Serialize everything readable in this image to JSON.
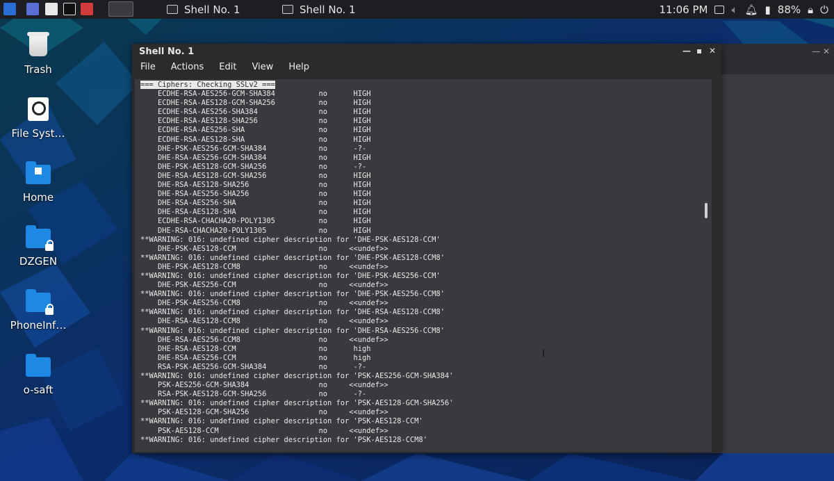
{
  "taskbar": {
    "tasks": [
      {
        "label": "Shell No. 1"
      },
      {
        "label": "Shell No. 1"
      }
    ],
    "clock": "11:06 PM",
    "battery": "88%"
  },
  "desktop": {
    "icons": [
      {
        "label": "Trash"
      },
      {
        "label": "File Syst…"
      },
      {
        "label": "Home"
      },
      {
        "label": "DZGEN"
      },
      {
        "label": "PhoneInf…"
      },
      {
        "label": "o-saft"
      }
    ]
  },
  "window": {
    "title": "Shell No. 1",
    "menu": [
      "File",
      "Actions",
      "Edit",
      "View",
      "Help"
    ],
    "header_line": "=== Ciphers: Checking SSLv2 ===",
    "lines": [
      "    ECDHE-RSA-AES256-GCM-SHA384          no      HIGH",
      "    ECDHE-RSA-AES128-GCM-SHA256          no      HIGH",
      "    ECDHE-RSA-AES256-SHA384              no      HIGH",
      "    ECDHE-RSA-AES128-SHA256              no      HIGH",
      "    ECDHE-RSA-AES256-SHA                 no      HIGH",
      "    ECDHE-RSA-AES128-SHA                 no      HIGH",
      "    DHE-PSK-AES256-GCM-SHA384            no      -?-",
      "    DHE-RSA-AES256-GCM-SHA384            no      HIGH",
      "    DHE-PSK-AES128-GCM-SHA256            no      -?-",
      "    DHE-RSA-AES128-GCM-SHA256            no      HIGH",
      "    DHE-RSA-AES128-SHA256                no      HIGH",
      "    DHE-RSA-AES256-SHA256                no      HIGH",
      "    DHE-RSA-AES256-SHA                   no      HIGH",
      "    DHE-RSA-AES128-SHA                   no      HIGH",
      "    ECDHE-RSA-CHACHA20-POLY1305          no      HIGH",
      "    DHE-RSA-CHACHA20-POLY1305            no      HIGH",
      "**WARNING: 016: undefined cipher description for 'DHE-PSK-AES128-CCM'",
      "    DHE-PSK-AES128-CCM                   no     <<undef>>",
      "**WARNING: 016: undefined cipher description for 'DHE-PSK-AES128-CCM8'",
      "    DHE-PSK-AES128-CCM8                  no     <<undef>>",
      "**WARNING: 016: undefined cipher description for 'DHE-PSK-AES256-CCM'",
      "    DHE-PSK-AES256-CCM                   no     <<undef>>",
      "**WARNING: 016: undefined cipher description for 'DHE-PSK-AES256-CCM8'",
      "    DHE-PSK-AES256-CCM8                  no     <<undef>>",
      "**WARNING: 016: undefined cipher description for 'DHE-RSA-AES128-CCM8'",
      "    DHE-RSA-AES128-CCM8                  no     <<undef>>",
      "**WARNING: 016: undefined cipher description for 'DHE-RSA-AES256-CCM8'",
      "    DHE-RSA-AES256-CCM8                  no     <<undef>>",
      "    DHE-RSA-AES128-CCM                   no      high",
      "    DHE-RSA-AES256-CCM                   no      high",
      "    RSA-PSK-AES256-GCM-SHA384            no      -?-",
      "**WARNING: 016: undefined cipher description for 'PSK-AES256-GCM-SHA384'",
      "    PSK-AES256-GCM-SHA384                no     <<undef>>",
      "    RSA-PSK-AES128-GCM-SHA256            no      -?-",
      "**WARNING: 016: undefined cipher description for 'PSK-AES128-GCM-SHA256'",
      "    PSK-AES128-GCM-SHA256                no     <<undef>>",
      "**WARNING: 016: undefined cipher description for 'PSK-AES128-CCM'",
      "    PSK-AES128-CCM                       no     <<undef>>",
      "**WARNING: 016: undefined cipher description for 'PSK-AES128-CCM8'"
    ]
  },
  "colors": {
    "taskbar_bg": "#1d1e22",
    "terminal_bg": "#383a3d",
    "terminal_fg": "#e9e9e9",
    "folder": "#1e88e5"
  }
}
